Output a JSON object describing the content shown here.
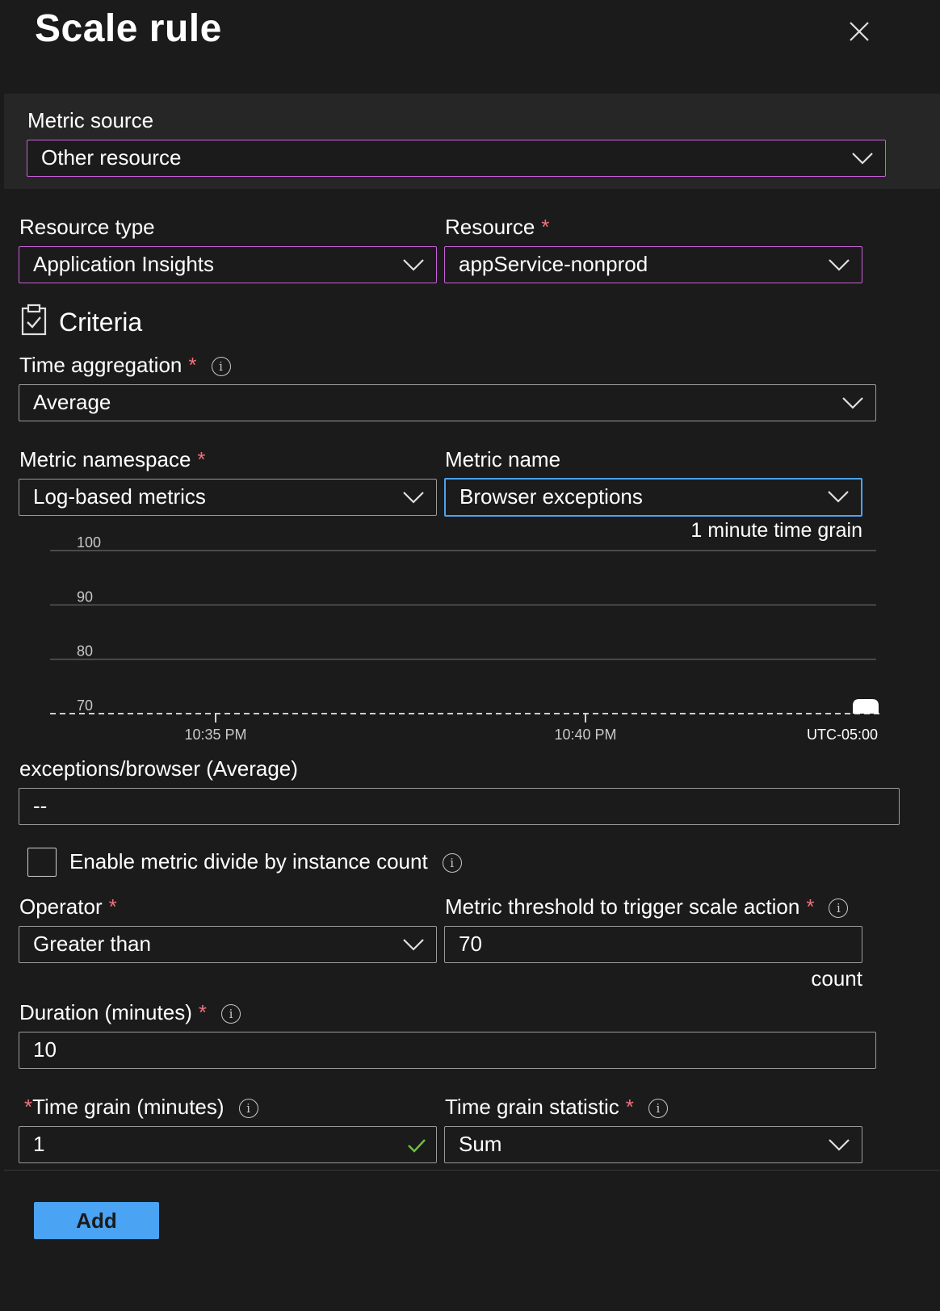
{
  "panel": {
    "title": "Scale rule",
    "close_icon": "close-icon"
  },
  "metric_source": {
    "label": "Metric source",
    "value": "Other resource"
  },
  "resource_type": {
    "label": "Resource type",
    "value": "Application Insights"
  },
  "resource": {
    "label": "Resource",
    "required": "*",
    "value": "appService-nonprod"
  },
  "criteria": {
    "title": "Criteria",
    "icon": "clipboard-check-icon"
  },
  "time_aggregation": {
    "label": "Time aggregation",
    "required": "*",
    "value": "Average"
  },
  "metric_namespace": {
    "label": "Metric namespace",
    "required": "*",
    "value": "Log-based metrics"
  },
  "metric_name": {
    "label": "Metric name",
    "value": "Browser exceptions"
  },
  "chart_data": {
    "type": "line",
    "caption": "1 minute time grain",
    "y_ticks": [
      "100",
      "90",
      "80",
      "70"
    ],
    "ylim": [
      70,
      100
    ],
    "x_ticks": [
      "10:35 PM",
      "10:40 PM"
    ],
    "timezone": "UTC-05:00",
    "threshold": 70,
    "grid": true,
    "series": []
  },
  "metric_value": {
    "label": "exceptions/browser (Average)",
    "value": "--"
  },
  "divide_checkbox": {
    "label": "Enable metric divide by instance count",
    "checked": false
  },
  "operator": {
    "label": "Operator",
    "required": "*",
    "value": "Greater than"
  },
  "threshold": {
    "label": "Metric threshold to trigger scale action",
    "required": "*",
    "value": "70",
    "unit": "count"
  },
  "duration": {
    "label": "Duration (minutes)",
    "required": "*",
    "value": "10"
  },
  "time_grain": {
    "required": "*",
    "label": "Time grain (minutes)",
    "value": "1"
  },
  "time_grain_statistic": {
    "label": "Time grain statistic",
    "required": "*",
    "value": "Sum"
  },
  "footer": {
    "add_label": "Add"
  },
  "colors": {
    "background": "#1b1b1b",
    "accent": "#4aa3f3",
    "required": "#f1707b",
    "hover_border": "#c860d8",
    "valid": "#6fbf40"
  }
}
